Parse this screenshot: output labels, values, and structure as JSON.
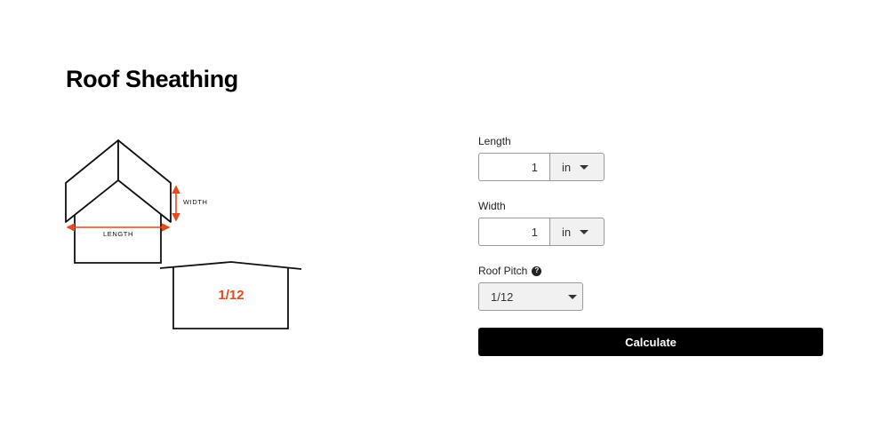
{
  "page": {
    "title": "Roof Sheathing"
  },
  "diagram": {
    "width_label": "WIDTH",
    "length_label": "LENGTH",
    "pitch_label": "1/12",
    "accent_color": "#e8491d"
  },
  "form": {
    "length": {
      "label": "Length",
      "value": "1",
      "unit": "in"
    },
    "width": {
      "label": "Width",
      "value": "1",
      "unit": "in"
    },
    "roof_pitch": {
      "label": "Roof Pitch",
      "help_glyph": "?",
      "selected": "1/12"
    },
    "calculate_label": "Calculate"
  }
}
